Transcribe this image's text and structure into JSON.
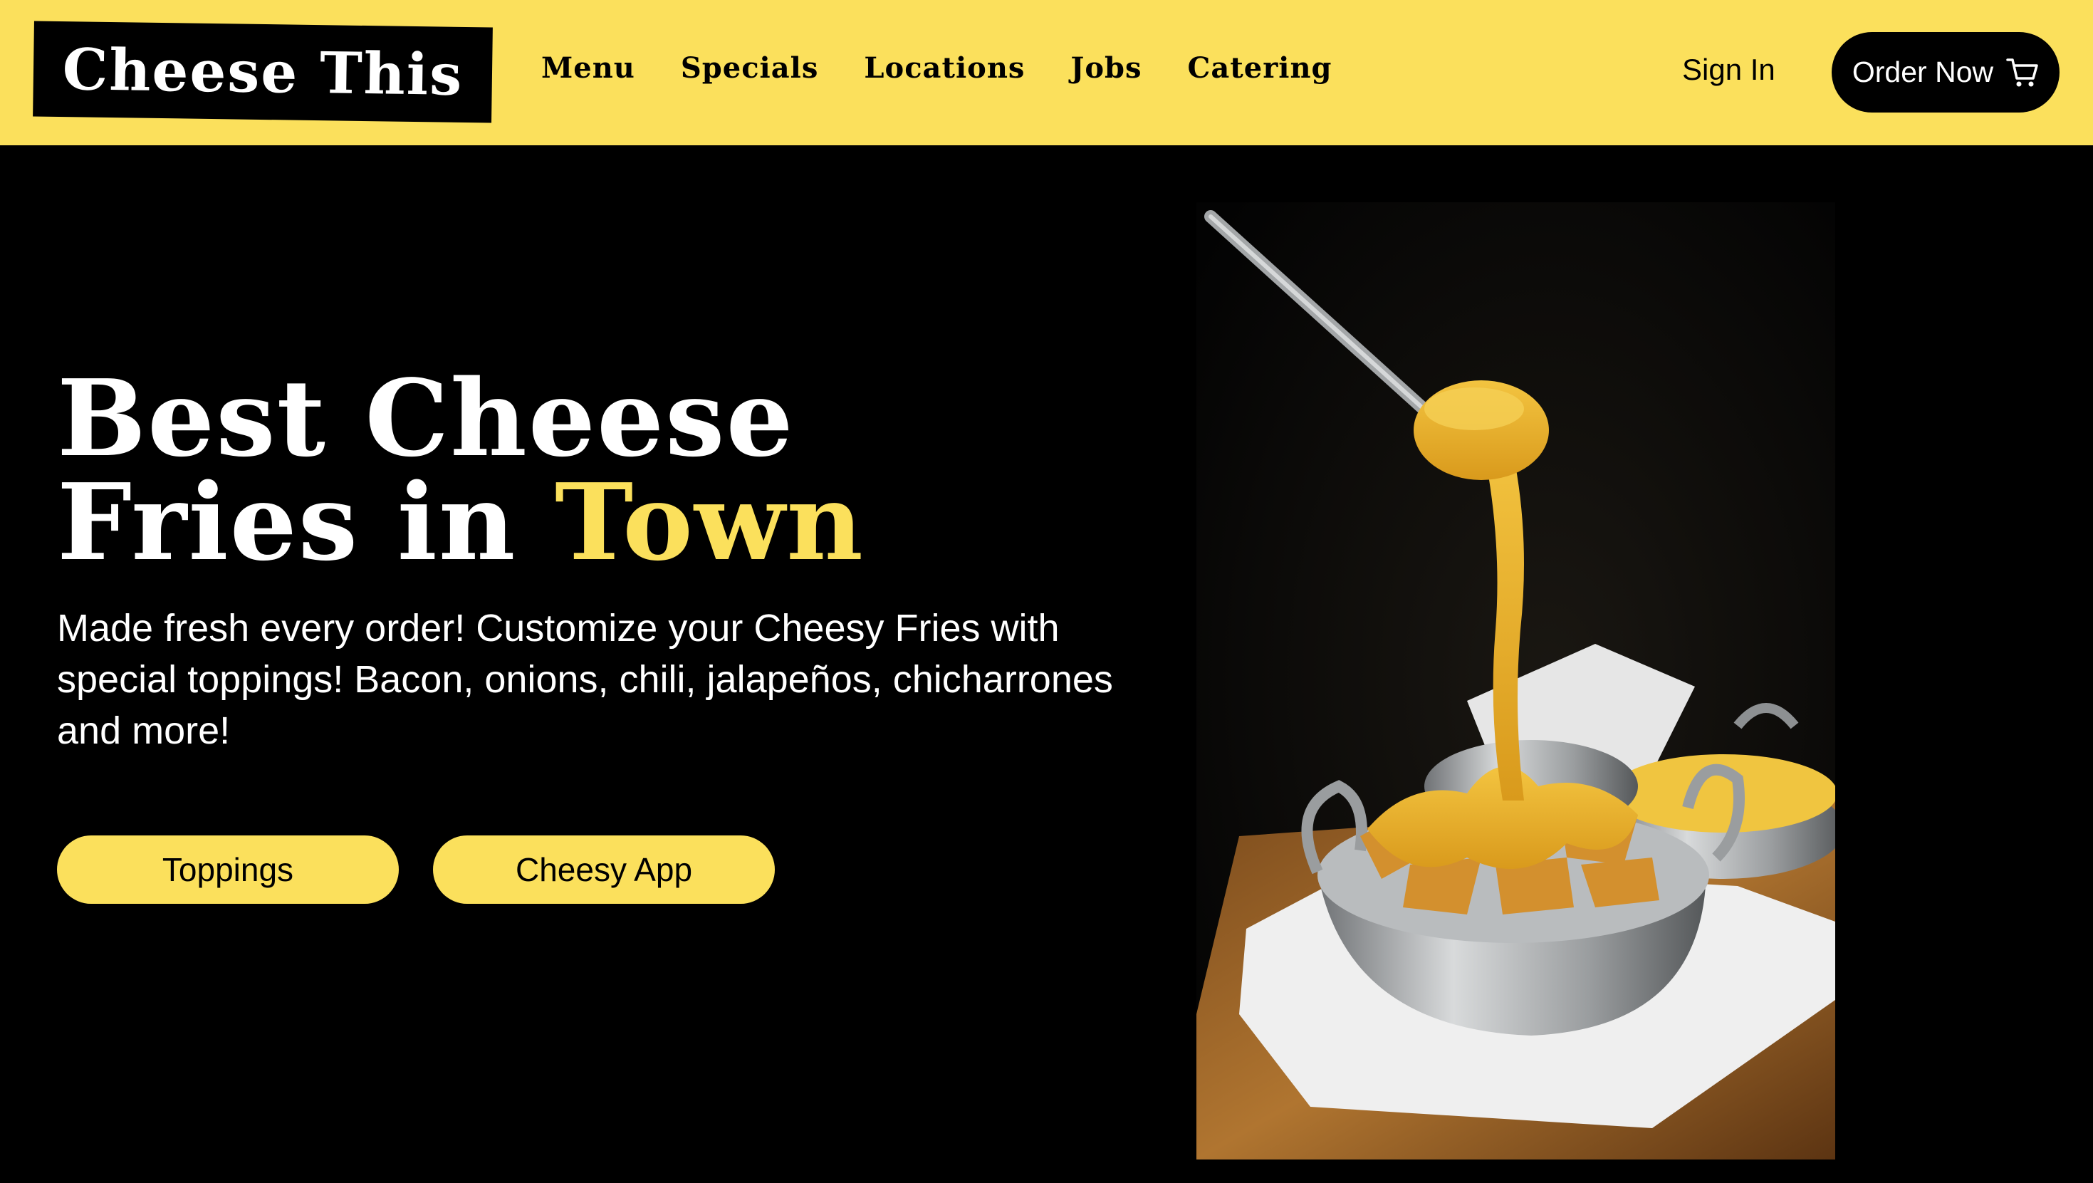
{
  "brand": {
    "name": "Cheese This"
  },
  "nav": [
    {
      "label": "Menu"
    },
    {
      "label": "Specials"
    },
    {
      "label": "Locations"
    },
    {
      "label": "Jobs"
    },
    {
      "label": "Catering"
    }
  ],
  "header": {
    "sign_in_label": "Sign In",
    "order_label": "Order Now",
    "order_icon": "cart-icon"
  },
  "hero": {
    "headline_line1": "Best Cheese",
    "headline_line2_prefix": "Fries in ",
    "headline_accent": "Town",
    "subtext": "Made fresh every order! Customize your Cheesy Fries with special toppings! Bacon, onions, chili, jalapeños, chicharrones and more!",
    "buttons": [
      {
        "label": "Toppings"
      },
      {
        "label": "Cheesy App"
      }
    ],
    "image": {
      "subject": "Cheese sauce ladled over fries in metal bowls"
    }
  },
  "colors": {
    "brand_yellow": "#FBE05C",
    "background": "#000000",
    "text_light": "#FFFFFF",
    "text_dark": "#000000"
  }
}
